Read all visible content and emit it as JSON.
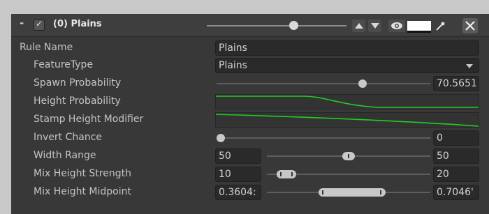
{
  "header": {
    "collapse_symbol": "-",
    "checkbox_mark": "✓",
    "title": "(0) Plains",
    "slider_level": 0.62,
    "color_swatch": "#ffffff",
    "icons": [
      "up-arrow-icon",
      "down-arrow-icon",
      "eye-icon",
      "eyedropper-icon",
      "close-icon"
    ]
  },
  "rows": {
    "rule_name": {
      "label": "Rule Name",
      "value": "Plains"
    },
    "feature_type": {
      "label": "FeatureType",
      "value": "Plains"
    },
    "spawn_probability": {
      "label": "Spawn Probability",
      "value": "70.5651",
      "level": 0.705651
    },
    "height_probability": {
      "label": "Height Probability",
      "curve_color": "#22cc22"
    },
    "stamp_height_modifier": {
      "label": "Stamp Height Modifier",
      "curve_color": "#22cc22"
    },
    "invert_chance": {
      "label": "Invert Chance",
      "value": "0",
      "level": 0
    },
    "width_range": {
      "label": "Width Range",
      "min": "50",
      "max": "50",
      "range": [
        0.5,
        0.5
      ]
    },
    "mix_height_strength": {
      "label": "Mix Height Strength",
      "min": "10",
      "max": "20",
      "range": [
        0.1,
        0.2
      ]
    },
    "mix_height_midpoint": {
      "label": "Mix Height Midpoint",
      "min": "0.3604:",
      "max": "0.7046'",
      "range": [
        0.3604,
        0.7046
      ]
    }
  }
}
